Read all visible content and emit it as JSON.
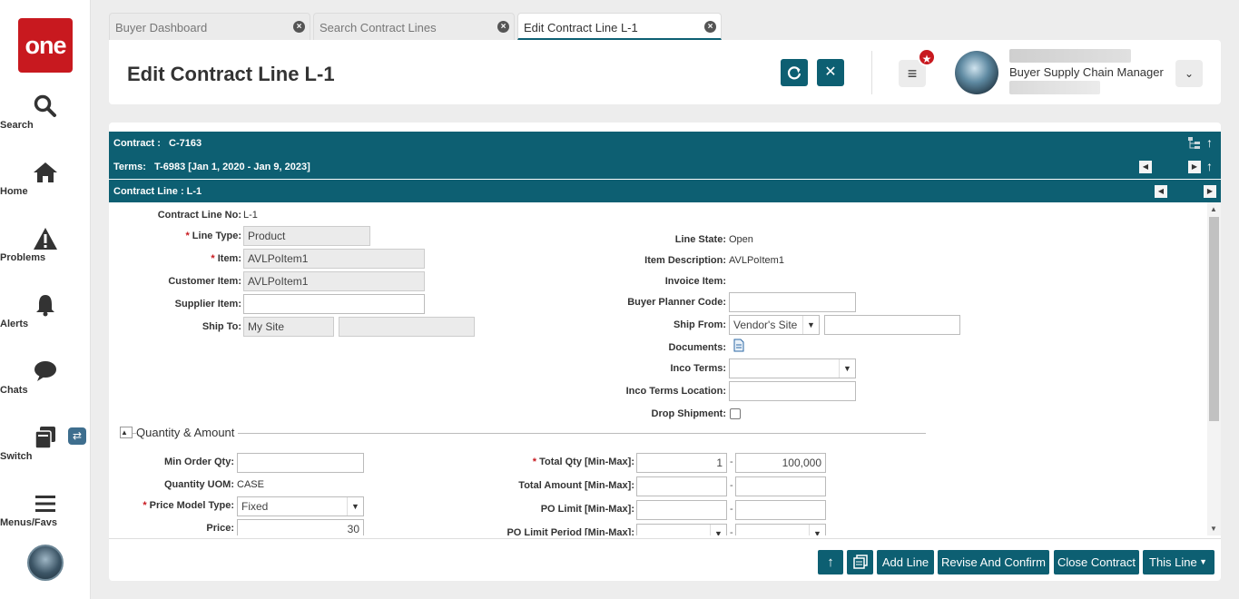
{
  "sidebar": {
    "logo": "one",
    "items": [
      {
        "label": "Search",
        "icon": "search-icon"
      },
      {
        "label": "Home",
        "icon": "home-icon"
      },
      {
        "label": "Problems",
        "icon": "warning-icon"
      },
      {
        "label": "Alerts",
        "icon": "bell-icon"
      },
      {
        "label": "Chats",
        "icon": "chat-icon"
      },
      {
        "label": "Switch",
        "icon": "switch-icon"
      },
      {
        "label": "Menus/Favs",
        "icon": "menu-icon"
      }
    ]
  },
  "tabs": [
    {
      "label": "Buyer Dashboard",
      "active": false
    },
    {
      "label": "Search Contract Lines",
      "active": false
    },
    {
      "label": "Edit Contract Line L-1",
      "active": true
    }
  ],
  "header": {
    "title": "Edit Contract Line L-1",
    "user_role": "Buyer Supply Chain Manager",
    "accent": "#0d5f72"
  },
  "bars": {
    "contract_label": "Contract :",
    "contract_value": "C-7163",
    "terms_label": "Terms:",
    "terms_value": "T-6983 [Jan 1, 2020 - Jan 9, 2023]",
    "line_label": "Contract Line : L-1"
  },
  "form": {
    "contract_line_no_label": "Contract Line No:",
    "contract_line_no": "L-1",
    "line_type_label": "Line Type:",
    "line_type": "Product",
    "item_label": "Item:",
    "item": "AVLPoItem1",
    "customer_item_label": "Customer Item:",
    "customer_item": "AVLPoItem1",
    "supplier_item_label": "Supplier Item:",
    "supplier_item": "",
    "ship_to_label": "Ship To:",
    "ship_to": "My Site",
    "ship_to_2": "",
    "line_state_label": "Line State:",
    "line_state": "Open",
    "item_description_label": "Item Description:",
    "item_description": "AVLPoItem1",
    "invoice_item_label": "Invoice Item:",
    "buyer_planner_code_label": "Buyer Planner Code:",
    "buyer_planner_code": "",
    "ship_from_label": "Ship From:",
    "ship_from": "Vendor's Site",
    "ship_from_2": "",
    "documents_label": "Documents:",
    "inco_terms_label": "Inco Terms:",
    "inco_terms": "",
    "inco_terms_location_label": "Inco Terms Location:",
    "inco_terms_location": "",
    "drop_shipment_label": "Drop Shipment:",
    "drop_shipment": false
  },
  "qty_section": {
    "title": "Quantity & Amount",
    "min_order_qty_label": "Min Order Qty:",
    "min_order_qty": "",
    "quantity_uom_label": "Quantity UOM:",
    "quantity_uom": "CASE",
    "price_model_type_label": "Price Model Type:",
    "price_model_type": "Fixed",
    "price_label": "Price:",
    "price": "30",
    "total_qty_label": "Total Qty [Min-Max]:",
    "total_qty_min": "1",
    "total_qty_max": "100,000",
    "total_amount_label": "Total Amount [Min-Max]:",
    "po_limit_label": "PO Limit [Min-Max]:",
    "po_limit_period_label": "PO Limit Period [Min-Max]:",
    "range_sep": "-"
  },
  "footer": {
    "add_line": "Add Line",
    "revise_and_confirm": "Revise And Confirm",
    "close_contract": "Close Contract",
    "this_line": "This Line"
  }
}
